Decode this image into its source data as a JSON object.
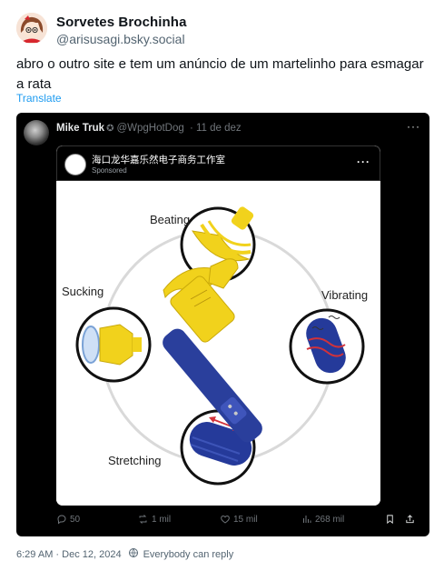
{
  "author": {
    "display_name": "Sorvetes Brochinha",
    "handle": "@arisusagi.bsky.social"
  },
  "post": {
    "text": "abro o outro site e tem um anúncio de um martelinho para esmagar a rata",
    "translate_label": "Translate",
    "timestamp": "6:29 AM · Dec 12, 2024",
    "reply_setting": "Everybody can reply"
  },
  "embed": {
    "name": "Mike Truk",
    "handle": "@WpgHotDog",
    "date": "· 11 de dez",
    "more": "···",
    "ad": {
      "company": "海口龙华嘉乐然电子商务工作室",
      "sponsored": "Sponsored",
      "more": "···",
      "labels": {
        "beating": "Beating",
        "sucking": "Sucking",
        "vibrating": "Vibrating",
        "stretching": "Stretching"
      }
    },
    "actions": {
      "replies": "50",
      "reposts": "1 mil",
      "likes": "15 mil",
      "views": "268 mil"
    }
  },
  "colors": {
    "link": "#1d9bf0",
    "text": "#0f1419",
    "muted": "#536471",
    "product_blue": "#2a3f9c",
    "product_yellow": "#f2d11b"
  },
  "icons": [
    "verified-badge-icon",
    "more-icon",
    "reply-icon",
    "repost-icon",
    "like-icon",
    "views-icon",
    "bookmark-icon",
    "share-icon",
    "globe-icon"
  ]
}
